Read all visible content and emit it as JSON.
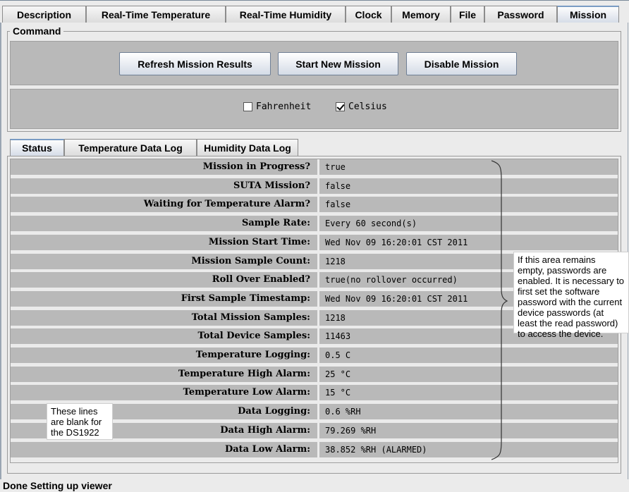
{
  "main_tabs": [
    "Description",
    "Real-Time Temperature",
    "Real-Time Humidity",
    "Clock",
    "Memory",
    "File",
    "Password",
    "Mission"
  ],
  "active_main_tab": "Mission",
  "command": {
    "title": "Command",
    "buttons": [
      "Refresh Mission Results",
      "Start New Mission",
      "Disable Mission"
    ],
    "fahrenheit": {
      "label": "Fahrenheit",
      "checked": false
    },
    "celsius": {
      "label": "Celsius",
      "checked": true
    }
  },
  "sub_tabs": [
    "Status",
    "Temperature Data Log",
    "Humidity Data Log"
  ],
  "active_sub_tab": "Status",
  "status_rows": [
    {
      "label": "Mission in Progress?",
      "value": "true"
    },
    {
      "label": "SUTA Mission?",
      "value": "false"
    },
    {
      "label": "Waiting for Temperature Alarm?",
      "value": "false"
    },
    {
      "label": "Sample Rate:",
      "value": "Every 60 second(s)"
    },
    {
      "label": "Mission Start Time:",
      "value": "Wed Nov 09 16:20:01 CST 2011"
    },
    {
      "label": "Mission Sample Count:",
      "value": "1218"
    },
    {
      "label": "Roll Over Enabled?",
      "value": "true(no rollover occurred)"
    },
    {
      "label": "First Sample Timestamp:",
      "value": "Wed Nov 09 16:20:01 CST 2011"
    },
    {
      "label": "Total Mission Samples:",
      "value": "1218"
    },
    {
      "label": "Total Device Samples:",
      "value": "11463"
    },
    {
      "label": "Temperature Logging:",
      "value": "0.5 C"
    },
    {
      "label": "Temperature High Alarm:",
      "value": "25 °C"
    },
    {
      "label": "Temperature Low Alarm:",
      "value": "15 °C"
    },
    {
      "label": "Data Logging:",
      "value": "0.6 %RH"
    },
    {
      "label": "Data High Alarm:",
      "value": "79.269 %RH"
    },
    {
      "label": "Data Low Alarm:",
      "value": "38.852 %RH (ALARMED)"
    }
  ],
  "notes": {
    "password": "If this area remains empty, passwords are enabled. It is necessary to first set the software password with the current device passwords (at least the read password) to access the device.",
    "ds1922": "These lines are blank for the DS1922"
  },
  "status_bar": "Done Setting up viewer"
}
